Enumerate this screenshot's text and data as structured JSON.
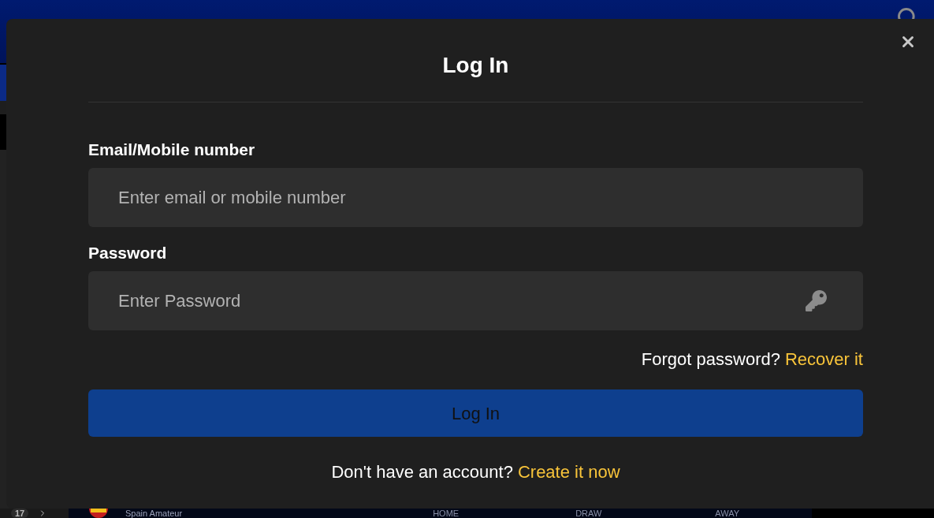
{
  "background": {
    "row_number": "17",
    "league": "Spain Amateur",
    "columns": [
      "HOME",
      "DRAW",
      "AWAY"
    ]
  },
  "modal": {
    "title": "Log In",
    "fields": [
      {
        "kind": "text",
        "label": "Email/Mobile number",
        "placeholder": "Enter email or mobile number"
      },
      {
        "kind": "password",
        "label": "Password",
        "placeholder": "Enter Password"
      }
    ],
    "forgot": {
      "text": "Forgot password?",
      "link": "Recover it"
    },
    "submit": "Log In",
    "signup": {
      "text": "Don't have an account?",
      "link": "Create it now"
    }
  }
}
